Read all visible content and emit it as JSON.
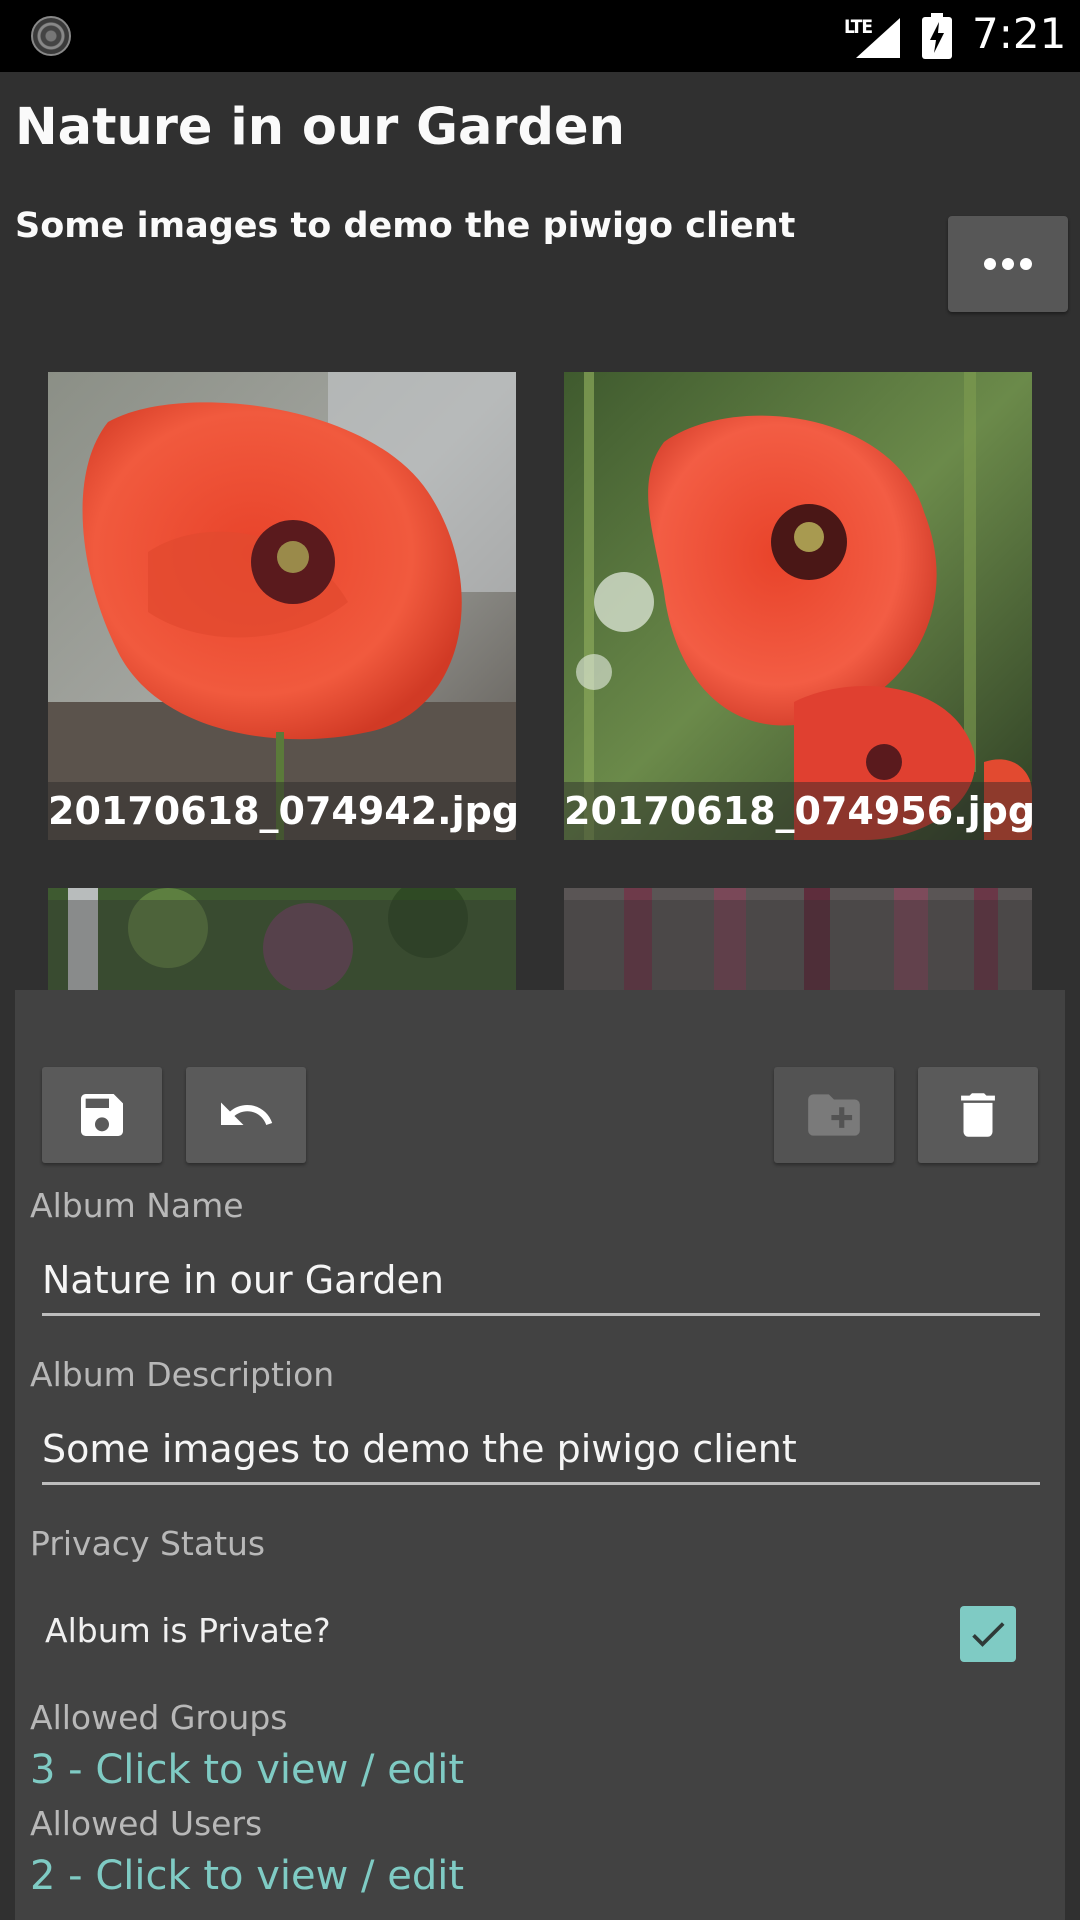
{
  "status_bar": {
    "network": "LTE",
    "time": "7:21",
    "icons": [
      "app-notification-icon",
      "signal-icon",
      "battery-charging-icon"
    ]
  },
  "header": {
    "title": "Nature in our Garden",
    "subtitle": "Some images to demo the piwigo client",
    "more_icon": "more-horizontal-icon"
  },
  "gallery": {
    "items": [
      {
        "caption": "20170618_074942.jpg"
      },
      {
        "caption": "20170618_074956.jpg"
      },
      {
        "caption": ""
      },
      {
        "caption": ""
      }
    ]
  },
  "edit_panel": {
    "toolbar": {
      "save_icon": "save-icon",
      "undo_icon": "undo-icon",
      "add_folder_icon": "create-new-folder-icon",
      "delete_icon": "delete-icon"
    },
    "album_name_label": "Album Name",
    "album_name_value": "Nature in our Garden",
    "album_description_label": "Album Description",
    "album_description_value": "Some images to demo the piwigo client",
    "privacy_status_label": "Privacy Status",
    "private_checkbox_label": "Album is Private?",
    "private_checked": true,
    "allowed_groups_label": "Allowed Groups",
    "allowed_groups_link": "3 - Click to view / edit",
    "allowed_users_label": "Allowed Users",
    "allowed_users_link": "2 - Click to view / edit"
  },
  "colors": {
    "background": "#303030",
    "panel": "#424242",
    "accent": "#7fcbc4",
    "button": "#5a5a5a"
  }
}
